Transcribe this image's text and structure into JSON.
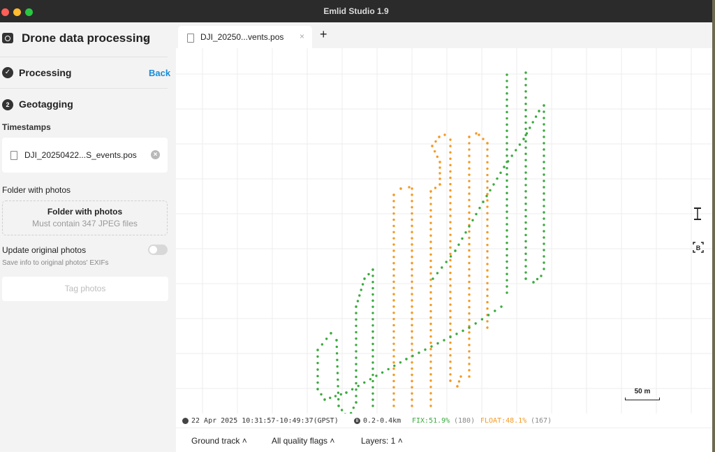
{
  "window": {
    "title": "Emlid Studio 1.9"
  },
  "sidebar": {
    "header_title": "Drone data processing",
    "step1_label": "Processing",
    "back_label": "Back",
    "step2_number": "2",
    "step2_label": "Geotagging",
    "timestamps_label": "Timestamps",
    "timestamps_file": "DJI_20250422...S_events.pos",
    "folder_label": "Folder with photos",
    "folder_drop_title": "Folder with photos",
    "folder_drop_hint": "Must contain 347 JPEG files",
    "update_label": "Update original photos",
    "update_hint": "Save info to original photos' EXIFs",
    "update_enabled": false,
    "tag_button_label": "Tag photos"
  },
  "tabs": [
    {
      "label": "DJI_20250...vents.pos"
    }
  ],
  "map": {
    "scale_label": "50 m",
    "fix_color": "#3aaa3e",
    "float_color": "#f39a22",
    "tools": {
      "height_icon": "height-range-icon",
      "base_icon": "base-station-icon"
    }
  },
  "status": {
    "datetime": "22 Apr 2025 10:31:57-10:49:37(GPST)",
    "baseline": "0.2-0.4km",
    "fix_label": "FIX:51.9%",
    "fix_count": "(180)",
    "float_label": "FLOAT:48.1%",
    "float_count": "(167)"
  },
  "bottom_bar": {
    "track_label": "Ground track",
    "quality_label": "All quality flags",
    "layers_label": "Layers: 1"
  }
}
